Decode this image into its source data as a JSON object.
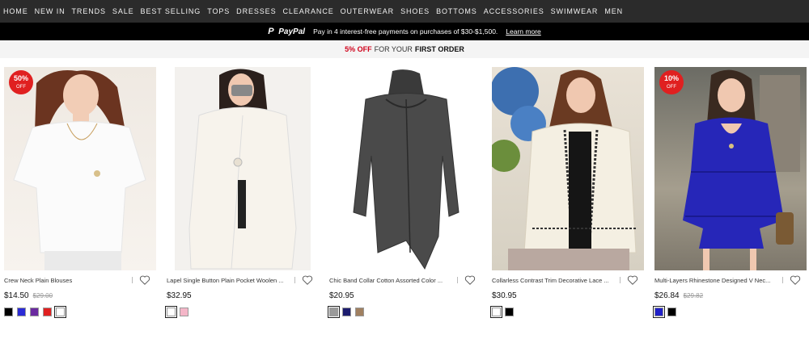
{
  "nav": {
    "items": [
      "HOME",
      "NEW IN",
      "TRENDS",
      "SALE",
      "BEST SELLING",
      "TOPS",
      "DRESSES",
      "CLEARANCE",
      "OUTERWEAR",
      "SHOES",
      "BOTTOMS",
      "ACCESSORIES",
      "SWIMWEAR",
      "MEN"
    ]
  },
  "paybar": {
    "brand": "PayPal",
    "text": "Pay in 4 interest-free payments on purchases of $30-$1,500.",
    "link": "Learn more"
  },
  "promo": {
    "discount": "5% OFF",
    "middle": "FOR YOUR",
    "highlight": "FIRST ORDER"
  },
  "products": [
    {
      "title": "Crew Neck Plain Blouses",
      "price": "$14.50",
      "old_price": "$29.00",
      "badge": "50%",
      "badge_sub": "OFF",
      "swatches": [
        "#000000",
        "#2b2bd6",
        "#6a2aa0",
        "#e02020",
        "#ffffff"
      ],
      "selected_swatch": 4
    },
    {
      "title": "Lapel Single Button Plain Pocket Woolen ...",
      "price": "$32.95",
      "old_price": "",
      "badge": "",
      "badge_sub": "",
      "swatches": [
        "#ffffff",
        "#f4b6c8"
      ],
      "selected_swatch": 0
    },
    {
      "title": "Chic Band Collar Cotton Assorted Color ...",
      "price": "$20.95",
      "old_price": "",
      "badge": "",
      "badge_sub": "",
      "swatches": [
        "#9a9a9a",
        "#1c1c6e",
        "#a08060"
      ],
      "selected_swatch": 0
    },
    {
      "title": "Collarless Contrast Trim Decorative Lace ...",
      "price": "$30.95",
      "old_price": "",
      "badge": "",
      "badge_sub": "",
      "swatches": [
        "#ffffff",
        "#000000"
      ],
      "selected_swatch": 0
    },
    {
      "title": "Multi-Layers Rhinestone Designed V Nec...",
      "price": "$26.84",
      "old_price": "$29.82",
      "badge": "10%",
      "badge_sub": "OFF",
      "swatches": [
        "#2020c8",
        "#000000"
      ],
      "selected_swatch": 0
    }
  ]
}
